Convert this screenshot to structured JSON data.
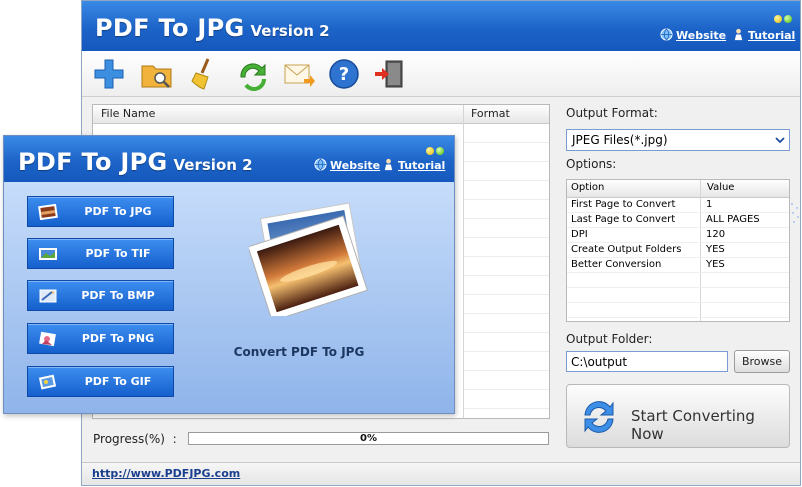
{
  "main_window": {
    "app_name": "PDF To JPG",
    "version": "Version 2",
    "website_link": "Website",
    "tutorial_link": "Tutorial",
    "toolbar": {
      "icons": [
        "add-icon",
        "open-folder-icon",
        "broom-icon",
        "refresh-icon",
        "mail-icon",
        "help-icon",
        "exit-icon"
      ]
    },
    "file_list": {
      "columns": [
        "File Name",
        "Format"
      ]
    },
    "progress_label": "Progress(%)",
    "progress_sep": ":",
    "progress_value": "0%",
    "progress_fraction": 0,
    "footer_url": "http://www.PDFJPG.com",
    "output_format_label": "Output Format:",
    "output_format_value": "JPEG Files(*.jpg)",
    "options_label": "Options:",
    "options_table": {
      "columns": [
        "Option",
        "Value"
      ],
      "rows": [
        {
          "option": "First Page to Convert",
          "value": "1"
        },
        {
          "option": "Last Page to Convert",
          "value": "ALL PAGES"
        },
        {
          "option": "DPI",
          "value": "120"
        },
        {
          "option": "Create Output Folders",
          "value": "YES"
        },
        {
          "option": "Better Conversion",
          "value": "YES"
        }
      ]
    },
    "output_folder_label": "Output Folder:",
    "output_folder_value": "C:\\output",
    "browse_label": "Browse",
    "convert_label": "Start Converting Now"
  },
  "overlay_window": {
    "app_name": "PDF To JPG",
    "version": "Version 2",
    "website_link": "Website",
    "tutorial_link": "Tutorial",
    "buttons": [
      {
        "label": "PDF To JPG",
        "icon": "jpg-image-icon"
      },
      {
        "label": "PDF To TIF",
        "icon": "tif-image-icon"
      },
      {
        "label": "PDF To BMP",
        "icon": "bmp-image-icon"
      },
      {
        "label": "PDF To PNG",
        "icon": "png-image-icon"
      },
      {
        "label": "PDF To GIF",
        "icon": "gif-image-icon"
      }
    ],
    "caption": "Convert PDF To JPG"
  },
  "colors": {
    "title_bar_blue": "#1d64c8",
    "overlay_body_blue": "#a2c3f2",
    "link_blue": "#1a3f8f"
  }
}
